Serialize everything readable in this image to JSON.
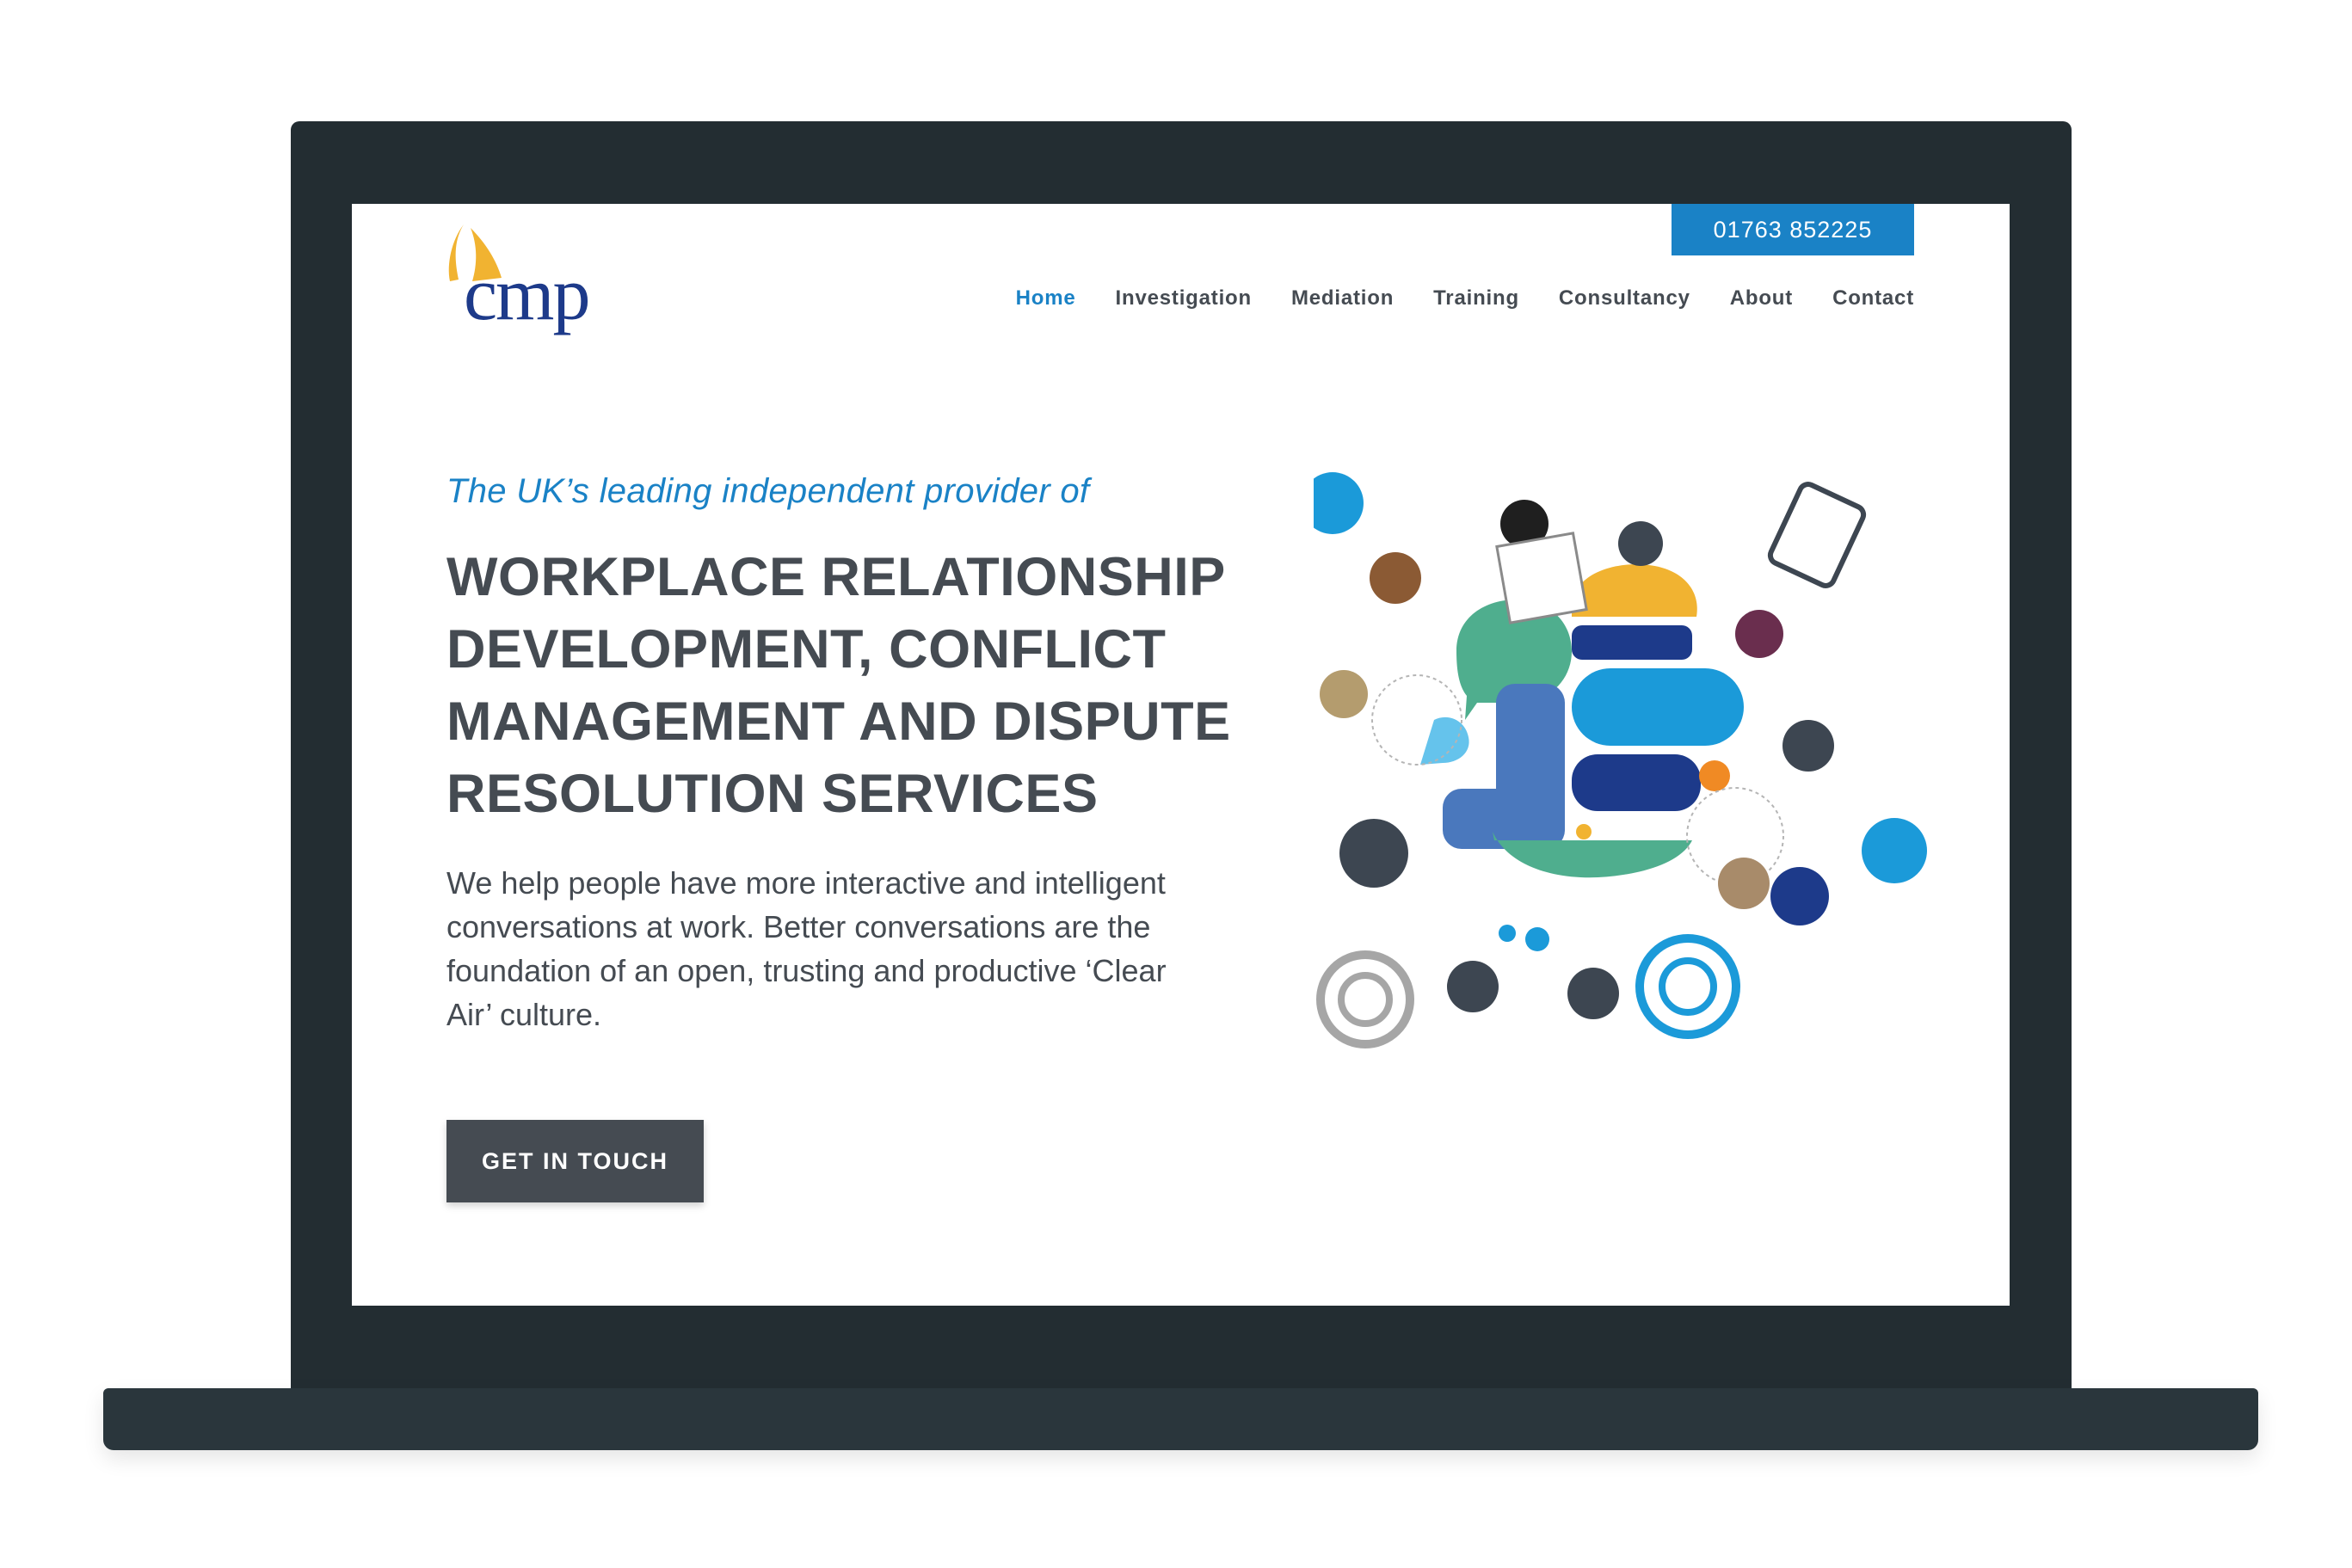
{
  "header": {
    "logo_text": "cmp",
    "phone": "01763 852225",
    "nav": [
      "Home",
      "Investigation",
      "Mediation",
      "Training",
      "Consultancy",
      "About",
      "Contact"
    ],
    "active_nav": "Home"
  },
  "hero": {
    "tagline": "The UK’s leading independent provider of",
    "headline_lines": [
      "WORKPLACE RELATIONSHIP",
      "DEVELOPMENT, CONFLICT",
      "MANAGEMENT AND DISPUTE",
      "RESOLUTION SERVICES"
    ],
    "body_lines": [
      "We help people have more interactive and intelligent",
      "conversations at work. Better conversations are the",
      "foundation of an open, trusting and productive ‘Clear",
      "Air’ culture."
    ],
    "cta_label": "GET IN TOUCH"
  },
  "colors": {
    "accent": "#1a82c6",
    "text_dark": "#454b52",
    "logo_blue": "#1d3a8a",
    "logo_gold": "#f1b331",
    "laptop_frame": "#232d32"
  }
}
